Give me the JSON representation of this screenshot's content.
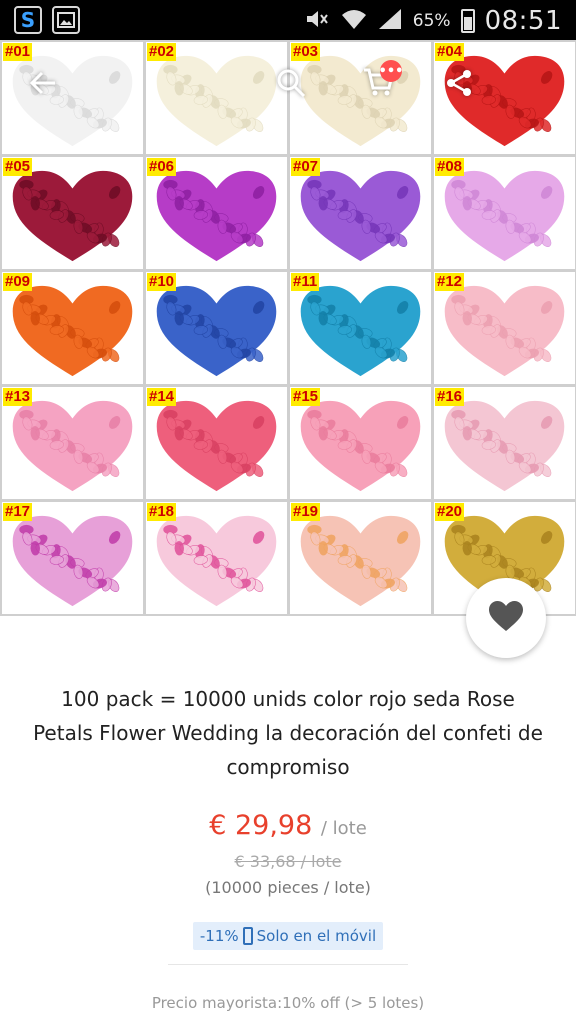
{
  "status_bar": {
    "battery_percent": "65%",
    "time": "08:51",
    "app_icon": "s-logo-icon",
    "gallery_icon": "image-icon"
  },
  "toolbar": {
    "back_icon": "arrow-back-icon",
    "search_icon": "search-icon",
    "cart_icon": "cart-icon",
    "cart_badge": "•••",
    "share_icon": "share-icon"
  },
  "swatches": [
    {
      "label": "#01",
      "color": "#f2f2f2",
      "accent": "#d9d9d9"
    },
    {
      "label": "#02",
      "color": "#f5f0dc",
      "accent": "#e2dbbf"
    },
    {
      "label": "#03",
      "color": "#f3ead0",
      "accent": "#ddd2b2"
    },
    {
      "label": "#04",
      "color": "#e02a2a",
      "accent": "#b51515"
    },
    {
      "label": "#05",
      "color": "#9c1a3a",
      "accent": "#6e0c25"
    },
    {
      "label": "#06",
      "color": "#b63cc7",
      "accent": "#8d1fa1"
    },
    {
      "label": "#07",
      "color": "#9a5ad6",
      "accent": "#7535b8"
    },
    {
      "label": "#08",
      "color": "#e6a9e8",
      "accent": "#cf86d6"
    },
    {
      "label": "#09",
      "color": "#f06a22",
      "accent": "#d44d0c"
    },
    {
      "label": "#10",
      "color": "#3a63c9",
      "accent": "#2244a3"
    },
    {
      "label": "#11",
      "color": "#2aa3cf",
      "accent": "#137fa8"
    },
    {
      "label": "#12",
      "color": "#f7bcc8",
      "accent": "#ec9fb0"
    },
    {
      "label": "#13",
      "color": "#f5a3c2",
      "accent": "#e77fa6"
    },
    {
      "label": "#14",
      "color": "#ee5f7c",
      "accent": "#d84061"
    },
    {
      "label": "#15",
      "color": "#f7a1b9",
      "accent": "#ea7c9c"
    },
    {
      "label": "#16",
      "color": "#f4c6d3",
      "accent": "#e79ab2"
    },
    {
      "label": "#17",
      "color": "#e7a0d8",
      "accent": "#c03aa9"
    },
    {
      "label": "#18",
      "color": "#f7c9dc",
      "accent": "#e0519a"
    },
    {
      "label": "#19",
      "color": "#f6c3b5",
      "accent": "#f0a35f"
    },
    {
      "label": "#20",
      "color": "#d2ad3c",
      "accent": "#a9821e"
    }
  ],
  "favorite_icon": "heart-icon",
  "product": {
    "title": "100 pack = 10000 unids color rojo seda Rose Petals Flower Wedding la decoración del confeti de compromiso",
    "price": "€ 29,98",
    "price_unit": "/ lote",
    "old_price": "€ 33,68 / lote",
    "pieces": "(10000 pieces / lote)",
    "discount": "-11%",
    "mobile_only": "Solo en el móvil",
    "wholesale": "Precio mayorista:10% off (> 5 lotes)"
  }
}
